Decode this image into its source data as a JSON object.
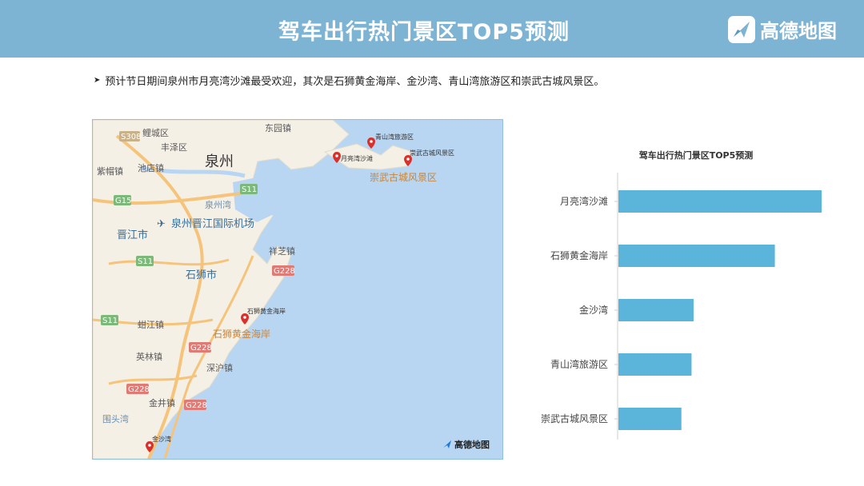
{
  "header": {
    "title": "驾车出行热门景区TOP5预测",
    "logo_text": "高德地图",
    "background": "#7db3d3"
  },
  "summary": {
    "bullet_symbol": "➤",
    "text": "预计节日期间泉州市月亮湾沙滩最受欢迎，其次是石狮黄金海岸、金沙湾、青山湾旅游区和崇武古城风景区。"
  },
  "map": {
    "logo_text": "高德地图",
    "place_labels": [
      "鲤城区",
      "丰泽区",
      "东园镇",
      "泉州",
      "紫帽镇",
      "池店镇",
      "泉州湾",
      "泉州晋江国际机场",
      "晋江市",
      "石狮市",
      "祥芝镇",
      "蚶江镇",
      "英林镇",
      "深沪镇",
      "金井镇",
      "围头湾",
      "崇武古城风景区",
      "石狮黄金海岸"
    ],
    "road_labels": [
      "S308",
      "S11",
      "G15",
      "S11",
      "S11",
      "G228",
      "G228",
      "G228",
      "G228"
    ],
    "markers": [
      {
        "name": "青山湾旅游区"
      },
      {
        "name": "月亮湾沙滩"
      },
      {
        "name": "崇武古城风景区"
      },
      {
        "name": "石狮黄金海岸"
      },
      {
        "name": "金沙湾"
      }
    ],
    "marker_color": "#d9302c"
  },
  "chart_data": {
    "type": "bar",
    "orientation": "horizontal",
    "title": "驾车出行热门景区TOP5预测",
    "categories": [
      "月亮湾沙滩",
      "石狮黄金海岸",
      "金沙湾",
      "青山湾旅游区",
      "崇武古城风景区"
    ],
    "values": [
      100,
      77,
      37,
      36,
      31
    ],
    "xlim": [
      0,
      100
    ],
    "grid": false,
    "bar_color": "#5bb4da"
  }
}
